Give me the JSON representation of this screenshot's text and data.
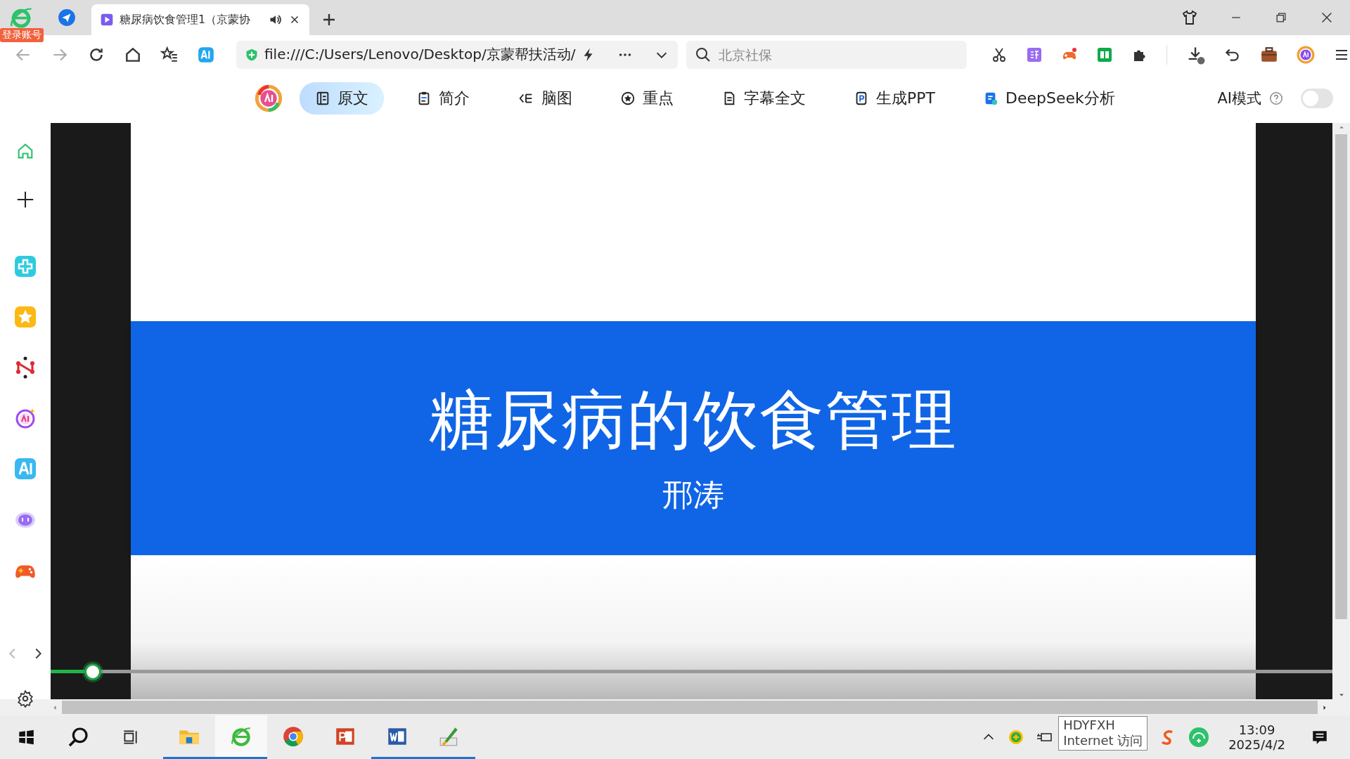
{
  "browser": {
    "account_badge": "登录账号",
    "tabs": [
      {
        "title": "糖尿病饮食管理1（京蒙协",
        "selected": true
      }
    ],
    "address": "file:///C:/Users/Lenovo/Desktop/京蒙帮扶活动/",
    "search": {
      "placeholder": "北京社保"
    }
  },
  "ai_toolbar": {
    "items": [
      {
        "label": "原文",
        "kind": "doc",
        "selected": true
      },
      {
        "label": "简介",
        "kind": "clipboard",
        "selected": false
      },
      {
        "label": "脑图",
        "kind": "mindmap",
        "selected": false
      },
      {
        "label": "重点",
        "kind": "star",
        "selected": false
      },
      {
        "label": "字幕全文",
        "kind": "page",
        "selected": false
      },
      {
        "label": "生成PPT",
        "kind": "ppt",
        "selected": false
      },
      {
        "label": "DeepSeek分析",
        "kind": "deepseek",
        "selected": false
      }
    ],
    "mode_label": "AI模式",
    "mode_on": false
  },
  "slide": {
    "title": "糖尿病的饮食管理",
    "subtitle": "邢涛"
  },
  "player": {
    "level": 0.033
  },
  "taskbar": {
    "apps": [
      {
        "kind": "folder",
        "open": true,
        "selected": false
      },
      {
        "kind": "ie",
        "open": true,
        "selected": true
      },
      {
        "kind": "chrome",
        "open": false,
        "selected": false
      },
      {
        "kind": "powerpoint",
        "open": false,
        "selected": false
      },
      {
        "kind": "word",
        "open": true,
        "selected": false
      },
      {
        "kind": "paint",
        "open": true,
        "selected": false
      }
    ],
    "tooltip": [
      "HDYFXH",
      "Internet 访问"
    ],
    "time": "13:09",
    "date": "2025/4/2"
  }
}
